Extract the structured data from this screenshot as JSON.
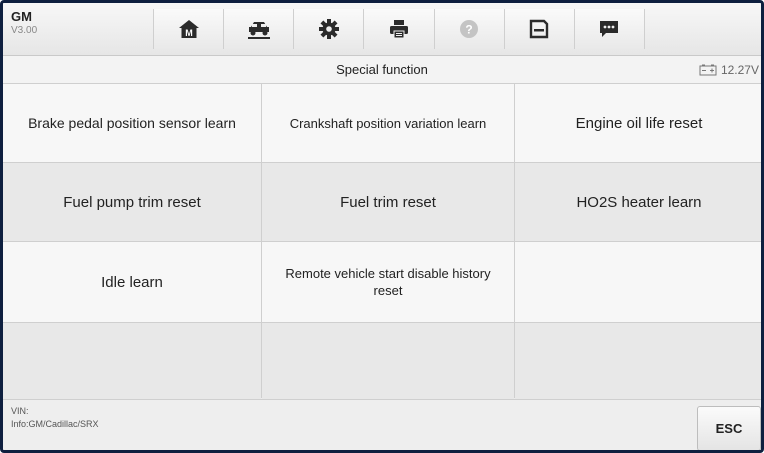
{
  "header": {
    "make": "GM",
    "version": "V3.00",
    "toolbar": [
      {
        "icon": "home-icon",
        "label": "M"
      },
      {
        "icon": "vehicle-lift-icon"
      },
      {
        "icon": "settings-gear-icon"
      },
      {
        "icon": "printer-icon"
      },
      {
        "icon": "help-icon"
      },
      {
        "icon": "save-icon"
      },
      {
        "icon": "message-icon"
      }
    ]
  },
  "titlebar": {
    "title": "Special function",
    "battery": "12.27V"
  },
  "functions": [
    [
      "Brake pedal position sensor learn",
      "Crankshaft position variation learn",
      "Engine oil life reset"
    ],
    [
      "Fuel pump trim reset",
      "Fuel trim reset",
      "HO2S heater learn"
    ],
    [
      "Idle learn",
      "Remote vehicle start disable history reset",
      ""
    ],
    [
      "",
      "",
      ""
    ]
  ],
  "footer": {
    "vin": "VIN:",
    "info": "Info:GM/Cadillac/SRX",
    "esc_label": "ESC"
  }
}
